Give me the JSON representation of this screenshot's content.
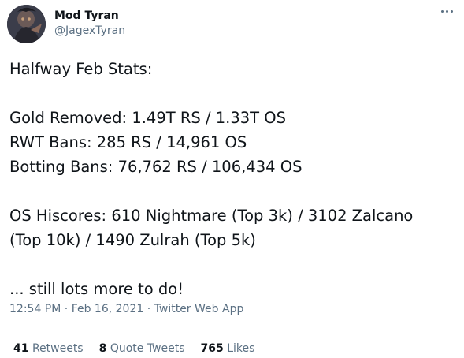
{
  "author": {
    "display_name": "Mod Tyran",
    "handle": "@JagexTyran"
  },
  "more_icon": "more-horizontal-icon",
  "tweet": {
    "lines": [
      "Halfway Feb Stats:",
      "",
      "Gold Removed: 1.49T RS / 1.33T OS",
      "RWT Bans: 285 RS / 14,961 OS",
      "Botting Bans: 76,762 RS / 106,434 OS",
      "",
      "OS Hiscores: 610 Nightmare (Top 3k) / 3102 Zalcano",
      "(Top 10k) / 1490 Zulrah (Top 5k)",
      "",
      "... still lots more to do!"
    ]
  },
  "meta": {
    "time": "12:54 PM",
    "sep1": " · ",
    "date": "Feb 16, 2021",
    "sep2": " · ",
    "app": "Twitter Web App"
  },
  "stats": {
    "retweets_count": "41",
    "retweets_label": "Retweets",
    "quotes_count": "8",
    "quotes_label": "Quote Tweets",
    "likes_count": "765",
    "likes_label": "Likes"
  },
  "colors": {
    "text": "#0f1419",
    "secondary": "#5b7083",
    "divider": "#e6ecf0"
  }
}
